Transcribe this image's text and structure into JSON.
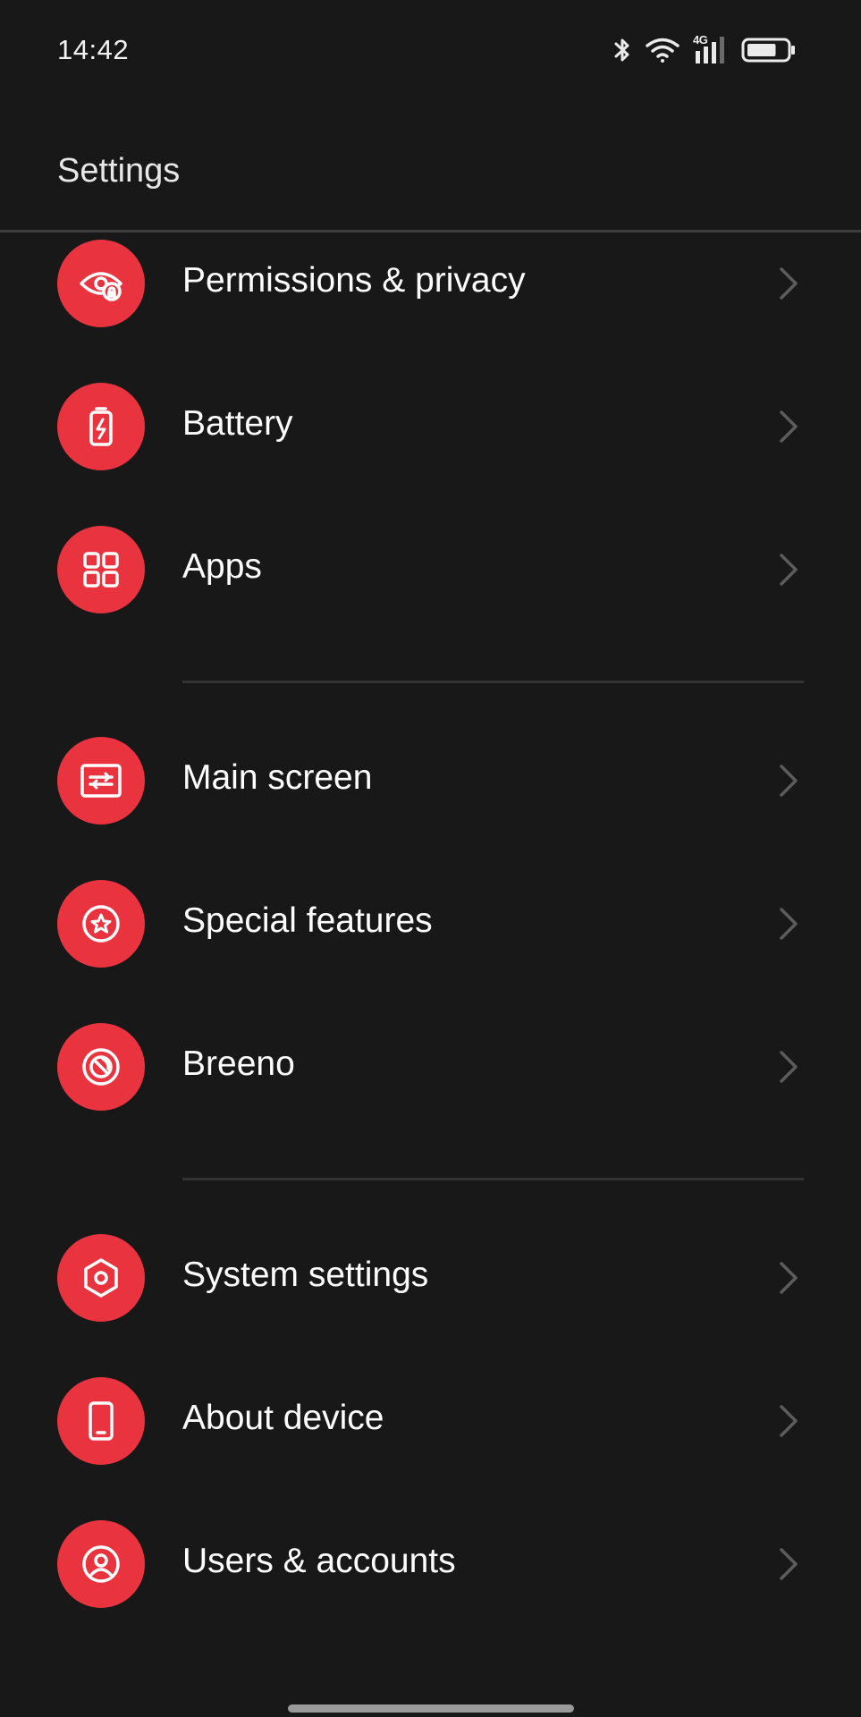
{
  "status_bar": {
    "time": "14:42",
    "network_label": "4G",
    "icons": [
      "bluetooth-icon",
      "wifi-icon",
      "cellular-signal-icon",
      "battery-icon"
    ],
    "battery_level": 0.75
  },
  "header": {
    "title": "Settings"
  },
  "colors": {
    "background": "#181818",
    "icon_circle": "#e9343f",
    "text": "#ffffff",
    "chevron": "#5c5c5c",
    "divider": "#333333"
  },
  "groups": [
    {
      "items": [
        {
          "label": "Permissions & privacy",
          "icon": "privacy-eye-icon"
        },
        {
          "label": "Battery",
          "icon": "battery-icon"
        },
        {
          "label": "Apps",
          "icon": "apps-grid-icon"
        }
      ]
    },
    {
      "items": [
        {
          "label": "Main screen",
          "icon": "main-screen-icon"
        },
        {
          "label": "Special features",
          "icon": "star-icon"
        },
        {
          "label": "Breeno",
          "icon": "breeno-icon"
        }
      ]
    },
    {
      "items": [
        {
          "label": "System settings",
          "icon": "hexagon-gear-icon"
        },
        {
          "label": "About device",
          "icon": "phone-icon"
        },
        {
          "label": "Users & accounts",
          "icon": "user-icon"
        }
      ]
    }
  ]
}
